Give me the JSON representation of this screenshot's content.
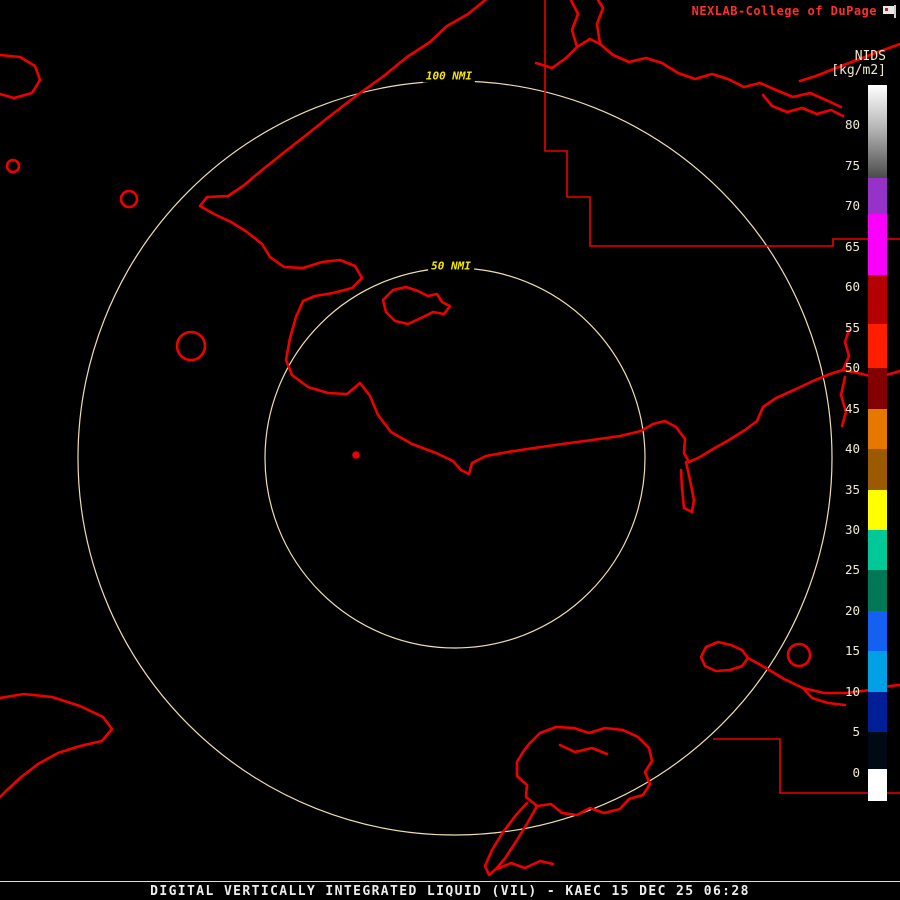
{
  "header": {
    "brand": "NEXLAB-College of DuPage"
  },
  "colorbar": {
    "title": "NIDS",
    "units": "[kg/m2]",
    "value_top": 85,
    "value_bottom": -3.5,
    "ticks": [
      80,
      75,
      70,
      65,
      60,
      55,
      50,
      45,
      40,
      35,
      30,
      25,
      20,
      15,
      10,
      5,
      0
    ],
    "segments": [
      {
        "hi": 85,
        "lo": 73.5,
        "color": "linear-gradient(to bottom,#ffffff,#b8b8b8 45%,#4b4b4b)"
      },
      {
        "hi": 73.5,
        "lo": 69,
        "color": "#9632c8"
      },
      {
        "hi": 69,
        "lo": 61.5,
        "color": "#fa00fa"
      },
      {
        "hi": 61.5,
        "lo": 55.5,
        "color": "#b40000"
      },
      {
        "hi": 55.5,
        "lo": 50,
        "color": "#ff1e00"
      },
      {
        "hi": 50,
        "lo": 45,
        "color": "#820000"
      },
      {
        "hi": 45,
        "lo": 40,
        "color": "#e67800"
      },
      {
        "hi": 40,
        "lo": 35,
        "color": "#9b5a00"
      },
      {
        "hi": 35,
        "lo": 30,
        "color": "#ffff00"
      },
      {
        "hi": 30,
        "lo": 25,
        "color": "#00c896"
      },
      {
        "hi": 25,
        "lo": 20,
        "color": "#007855"
      },
      {
        "hi": 20,
        "lo": 15,
        "color": "#1460f0"
      },
      {
        "hi": 15,
        "lo": 10,
        "color": "#00a0e6"
      },
      {
        "hi": 10,
        "lo": 5,
        "color": "#001e96"
      },
      {
        "hi": 5,
        "lo": 0.5,
        "color": "#000a14"
      },
      {
        "hi": 0.5,
        "lo": -3.5,
        "color": "#ffffff"
      }
    ]
  },
  "rings": {
    "outer_label": "100 NMI",
    "inner_label": "50 NMI"
  },
  "footer": {
    "caption": "DIGITAL VERTICALLY INTEGRATED LIQUID (VIL) - KAEC 15 DEC 25 06:28"
  },
  "colors": {
    "background": "#000000",
    "map_outline": "#ee0000",
    "range_ring": "#f0ddb4",
    "ring_label": "#f6e800",
    "brand_text": "#ff2e2e",
    "scale_text": "#f2ead0",
    "footer_text": "#ededed"
  }
}
